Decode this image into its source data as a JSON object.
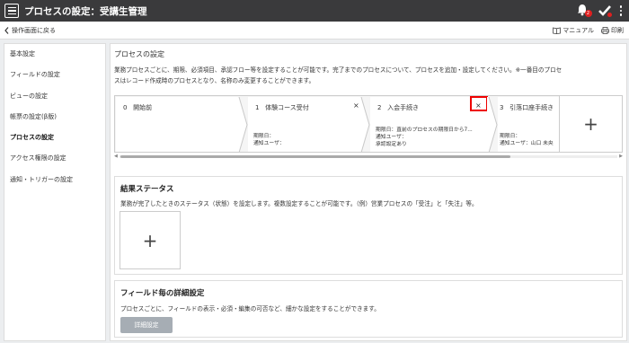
{
  "header": {
    "title": "プロセスの設定：受講生管理",
    "notification_count": "2"
  },
  "subbar": {
    "back_label": "操作画面に戻る",
    "manual_label": "マニュアル",
    "print_label": "印刷"
  },
  "sidebar": {
    "items": [
      {
        "label": "基本設定"
      },
      {
        "label": "フィールドの設定"
      },
      {
        "label": "ビューの設定"
      },
      {
        "label": "帳票の設定(β版)"
      },
      {
        "label": "プロセスの設定"
      },
      {
        "label": "アクセス権限の設定"
      },
      {
        "label": "通知・トリガーの設定"
      }
    ]
  },
  "main": {
    "title": "プロセスの設定",
    "description_1": "業務プロセスごとに、期限、必須項目、承認フロー等を設定することが可能です。完了までのプロセスについて、プロセスを追加・設定してください。※一番目のプロセ",
    "description_2": "スはレコード作成時のプロセスとなり、名称のみ変更することができます。",
    "processes": [
      {
        "number": "0",
        "name": "開始前"
      },
      {
        "number": "1",
        "name": "体験コース受付",
        "close": "×",
        "line1": "期限日：",
        "line2": "通知ユーザ："
      },
      {
        "number": "2",
        "name": "入会手続き",
        "close": "×",
        "line1": "期限日：直前のプロセスの期限日から7...",
        "line2": "通知ユーザ：",
        "line3": "承認設定あり"
      },
      {
        "number": "3",
        "name": "引落口座手続き",
        "line1": "期限日：",
        "line2": "通知ユーザ：山口 未央"
      }
    ],
    "add_process": "+"
  },
  "result_status": {
    "title": "結果ステータス",
    "description": "業務が完了したときのステータス（状態）を設定します。複数設定することが可能です。（例）営業プロセスの「受注」と「失注」等。",
    "add": "+"
  },
  "field_detail": {
    "title": "フィールド毎の詳細設定",
    "description": "プロセスごとに、フィールドの表示・必須・編集の可否など、細かな設定をすることができます。",
    "button": "詳細設定"
  }
}
